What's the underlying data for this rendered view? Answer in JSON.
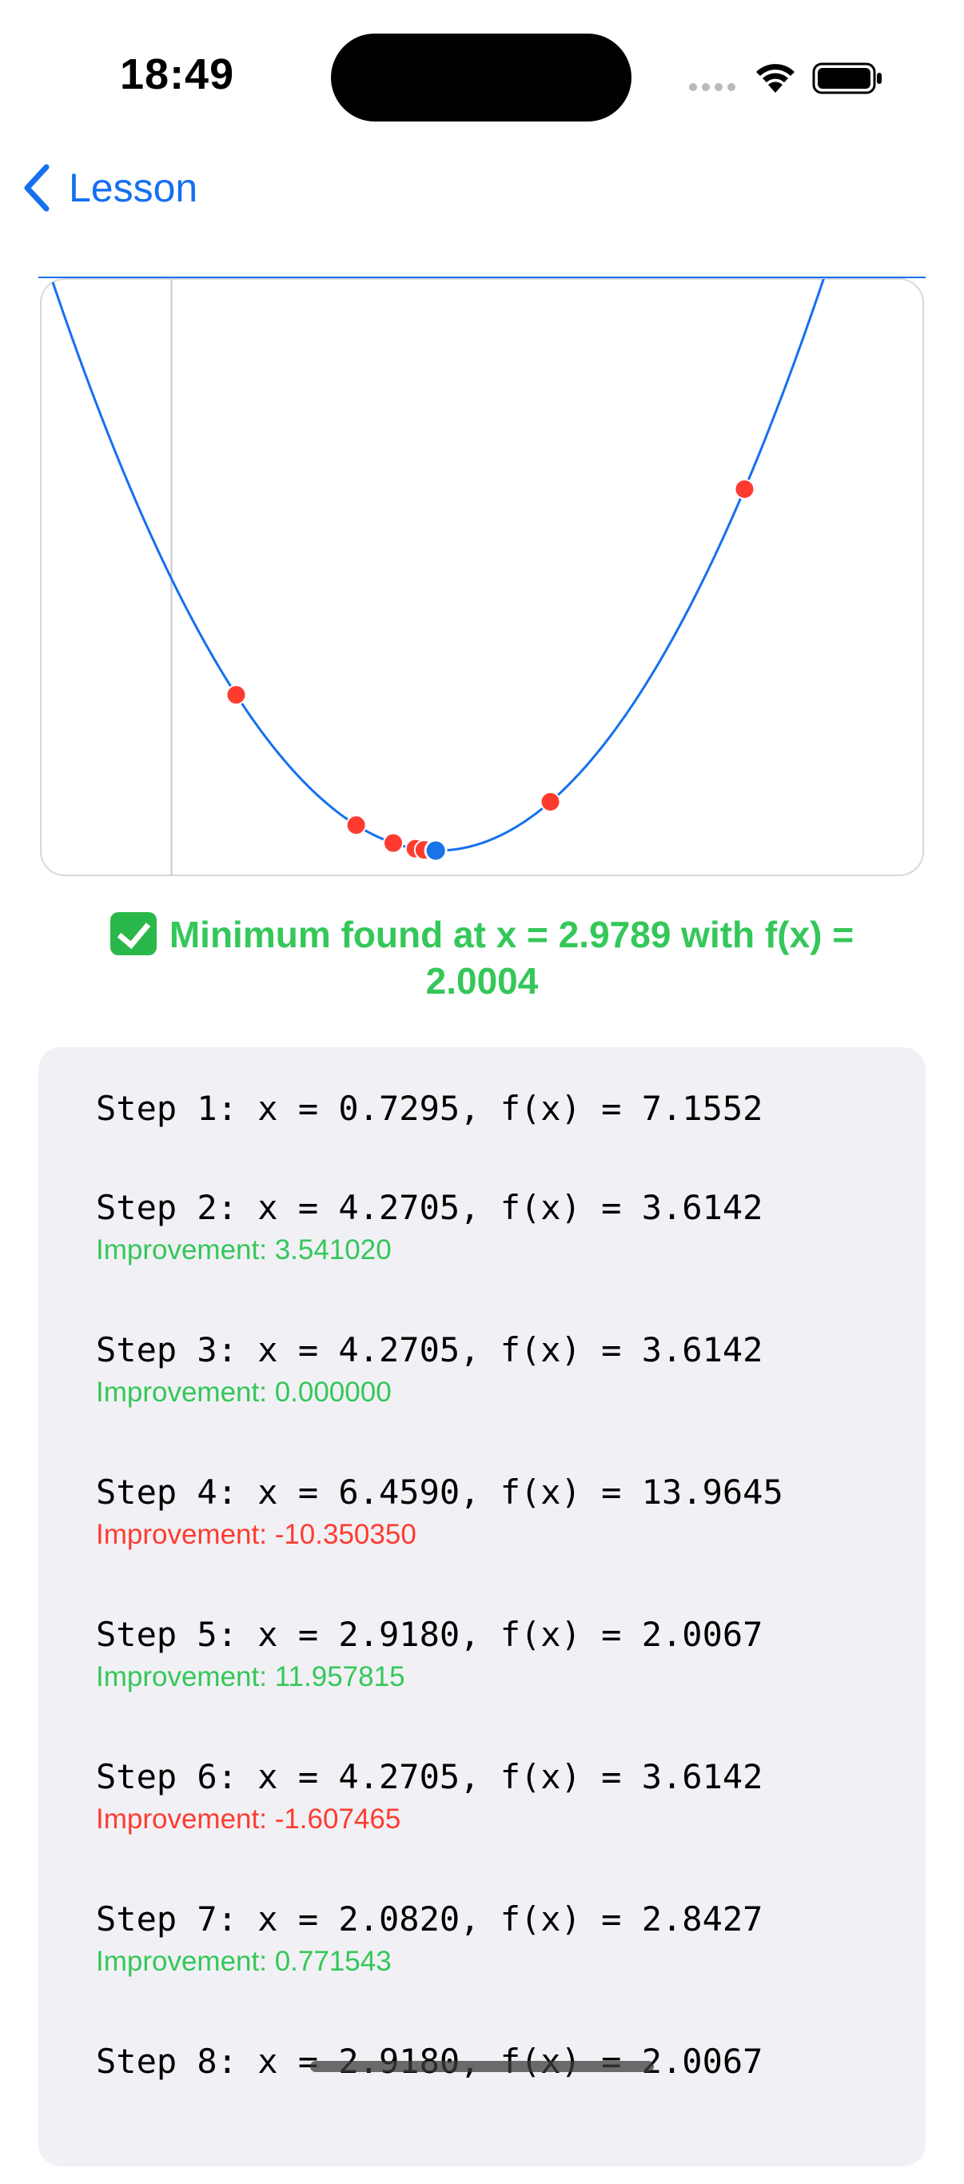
{
  "status_bar": {
    "time": "18:49"
  },
  "nav": {
    "back_label": "Lesson"
  },
  "result": {
    "message": "Minimum found at x = 2.9789 with f(x) = 2.0004"
  },
  "steps": [
    {
      "label": "Step 1: x = 0.7295, f(x) = 7.1552",
      "improvement": ""
    },
    {
      "label": "Step 2: x = 4.2705, f(x) = 3.6142",
      "improvement": "Improvement: 3.541020",
      "positive": true
    },
    {
      "label": "Step 3: x = 4.2705, f(x) = 3.6142",
      "improvement": "Improvement: 0.000000",
      "positive": true
    },
    {
      "label": "Step 4: x = 6.4590, f(x) = 13.9645",
      "improvement": "Improvement: -10.350350",
      "positive": false
    },
    {
      "label": "Step 5: x = 2.9180, f(x) = 2.0067",
      "improvement": "Improvement: 11.957815",
      "positive": true
    },
    {
      "label": "Step 6: x = 4.2705, f(x) = 3.6142",
      "improvement": "Improvement: -1.607465",
      "positive": false
    },
    {
      "label": "Step 7: x = 2.0820, f(x) = 2.8427",
      "improvement": "Improvement: 0.771543",
      "positive": true
    },
    {
      "label": "Step 8: x = 2.9180, f(x) = 2.0067",
      "improvement": ""
    }
  ],
  "chart_data": {
    "type": "scatter",
    "curve": "f(x) = (x - 3)^2 + 2",
    "xlim": [
      -1.5,
      8.5
    ],
    "ylim": [
      1.1,
      21
    ],
    "grid": false,
    "sample_points": [
      {
        "x": 0.7295,
        "y": 7.1552
      },
      {
        "x": 4.2705,
        "y": 3.6142
      },
      {
        "x": 6.459,
        "y": 13.9645
      },
      {
        "x": 2.918,
        "y": 2.0067
      },
      {
        "x": 2.082,
        "y": 2.8427
      },
      {
        "x": 2.5,
        "y": 2.25
      },
      {
        "x": 2.75,
        "y": 2.0625
      },
      {
        "x": 2.85,
        "y": 2.0225
      }
    ],
    "minimum_point": {
      "x": 2.9789,
      "y": 2.0004
    },
    "colors": {
      "curve": "#1570ef",
      "points": "#ff3b30",
      "minimum": "#1a73e8",
      "axis": "#c7c7cc"
    }
  },
  "colors": {
    "accent": "#1570ef",
    "success": "#34c759",
    "error": "#ff3b30",
    "panel_bg": "#f1f1f5"
  }
}
